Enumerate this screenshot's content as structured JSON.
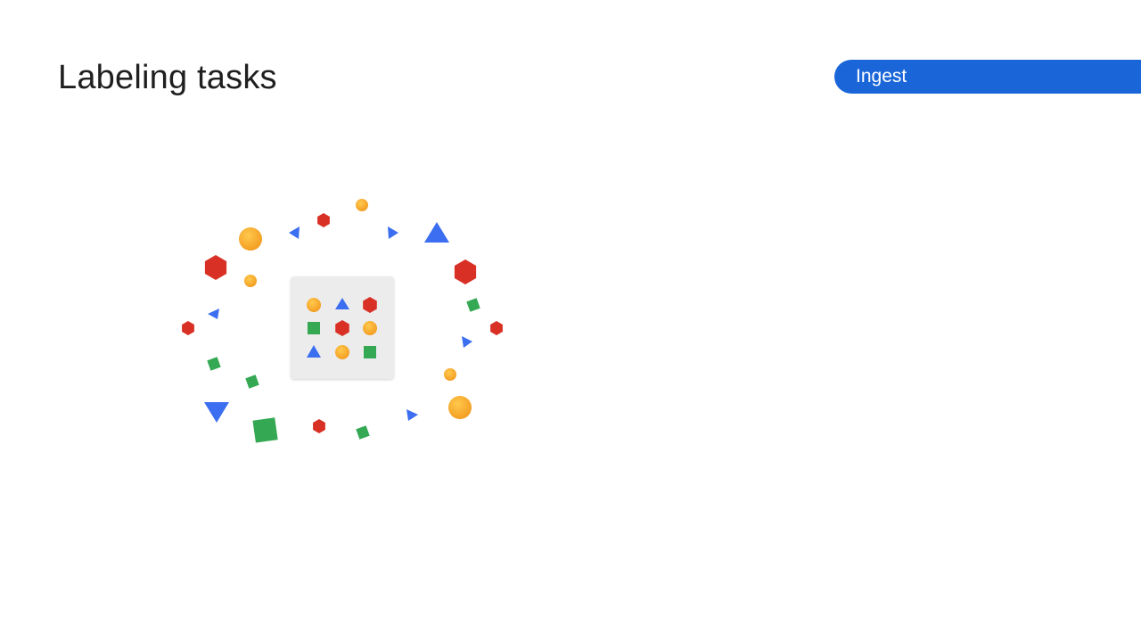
{
  "slide": {
    "title": "Labeling tasks",
    "stage_label": "Ingest"
  },
  "colors": {
    "background": "#ffffff",
    "pill": "#1a66d9",
    "title_text": "#1f1f1f",
    "red": "#d93025",
    "blue": "#3b6ef0",
    "green": "#34a853",
    "orange": "#f5a623",
    "panel": "#ececec"
  },
  "illustration": {
    "description_icon": "scattered-shapes-around-dataset-grid-icon"
  }
}
